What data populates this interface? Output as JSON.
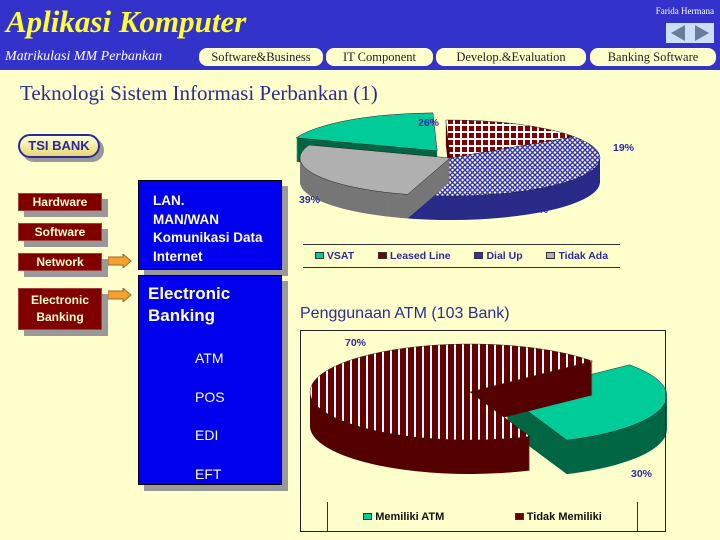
{
  "header": {
    "app_title": "Aplikasi Komputer",
    "author": "Farida Hermana",
    "subtitle": "Matrikulasi MM Perbankan",
    "tabs": [
      {
        "label": "Software&Business"
      },
      {
        "label": "IT Component"
      },
      {
        "label": "Develop.&Evaluation"
      },
      {
        "label": "Banking Software"
      }
    ],
    "nav_icons": [
      "previous-arrow-icon",
      "next-arrow-icon"
    ]
  },
  "slide": {
    "title": "Teknologi Sistem Informasi Perbankan (1)",
    "badge": "TSI BANK",
    "components": [
      {
        "label": "Hardware"
      },
      {
        "label": "Software"
      },
      {
        "label": "Network"
      },
      {
        "label": "Electronic Banking"
      }
    ],
    "network_box": [
      "LAN.",
      "MAN/WAN",
      "Komunikasi Data",
      "Internet"
    ],
    "ebanking_box": {
      "title": "Electronic Banking",
      "items": [
        "ATM",
        "POS",
        "EDI",
        "EFT"
      ]
    }
  },
  "colors": {
    "header": "#3333cc",
    "background": "#ffffcc",
    "accent_title": "#ffff33",
    "component_box": "#800000",
    "info_box": "#0000ee"
  },
  "chart_data": [
    {
      "type": "pie",
      "title": "",
      "labels": [
        "VSAT",
        "Leased Line",
        "Dial Up",
        "Tidak Ada"
      ],
      "values": [
        19,
        16,
        39,
        26
      ],
      "data_labels": [
        "19%",
        "16%",
        "39%",
        "26%"
      ],
      "colors": [
        "#00cc99",
        "#800000",
        "#3333aa",
        "#b0b0b0"
      ],
      "legend": "bottom",
      "exploded": [
        "VSAT"
      ],
      "3d": true
    },
    {
      "type": "pie",
      "title": "Penggunaan ATM  (103 Bank)",
      "labels": [
        "Memiliki ATM",
        "Tidak Memiliki"
      ],
      "values": [
        30,
        70
      ],
      "data_labels": [
        "30%",
        "70%"
      ],
      "colors": [
        "#00cc99",
        "#660000"
      ],
      "legend": "bottom",
      "exploded": [
        "Memiliki ATM"
      ],
      "3d": true
    }
  ]
}
